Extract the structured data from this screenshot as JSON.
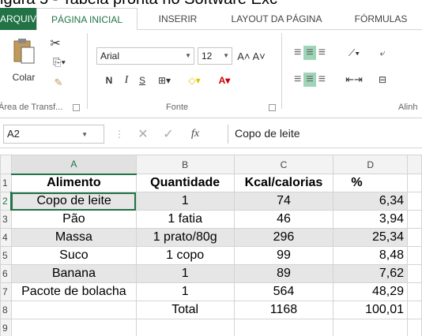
{
  "caption": "igura 5 - Tabela pronta no Software Exc",
  "tabs": [
    "ARQUIVO",
    "PÁGINA INICIAL",
    "INSERIR",
    "LAYOUT DA PÁGINA",
    "FÓRMULAS"
  ],
  "ribbon": {
    "paste_label": "Colar",
    "font_name": "Arial",
    "font_size": "12",
    "group_clipboard": "Área de Transf...",
    "group_font": "Fonte",
    "group_align": "Alinh",
    "bold": "N",
    "italic": "I",
    "underline": "S"
  },
  "formula_bar": {
    "name_box": "A2",
    "fx": "fx",
    "content": "Copo de leite"
  },
  "columns": [
    "A",
    "B",
    "C",
    "D"
  ],
  "rows": [
    {
      "num": "1",
      "cells": [
        "Alimento",
        "Quantidade",
        "Kcal/calorias",
        "%"
      ]
    },
    {
      "num": "2",
      "cells": [
        "Copo de leite",
        "1",
        "74",
        "6,34"
      ]
    },
    {
      "num": "3",
      "cells": [
        "Pão",
        "1 fatia",
        "46",
        "3,94"
      ]
    },
    {
      "num": "4",
      "cells": [
        "Massa",
        "1 prato/80g",
        "296",
        "25,34"
      ]
    },
    {
      "num": "5",
      "cells": [
        "Suco",
        "1 copo",
        "99",
        "8,48"
      ]
    },
    {
      "num": "6",
      "cells": [
        "Banana",
        "1",
        "89",
        "7,62"
      ]
    },
    {
      "num": "7",
      "cells": [
        "Pacote de bolacha",
        "1",
        "564",
        "48,29"
      ]
    },
    {
      "num": "8",
      "cells": [
        "",
        "Total",
        "1168",
        "100,01"
      ]
    },
    {
      "num": "9",
      "cells": [
        "",
        "",
        "",
        ""
      ]
    }
  ],
  "colors": {
    "accent": "#217346",
    "band": "#e6e6e6"
  }
}
